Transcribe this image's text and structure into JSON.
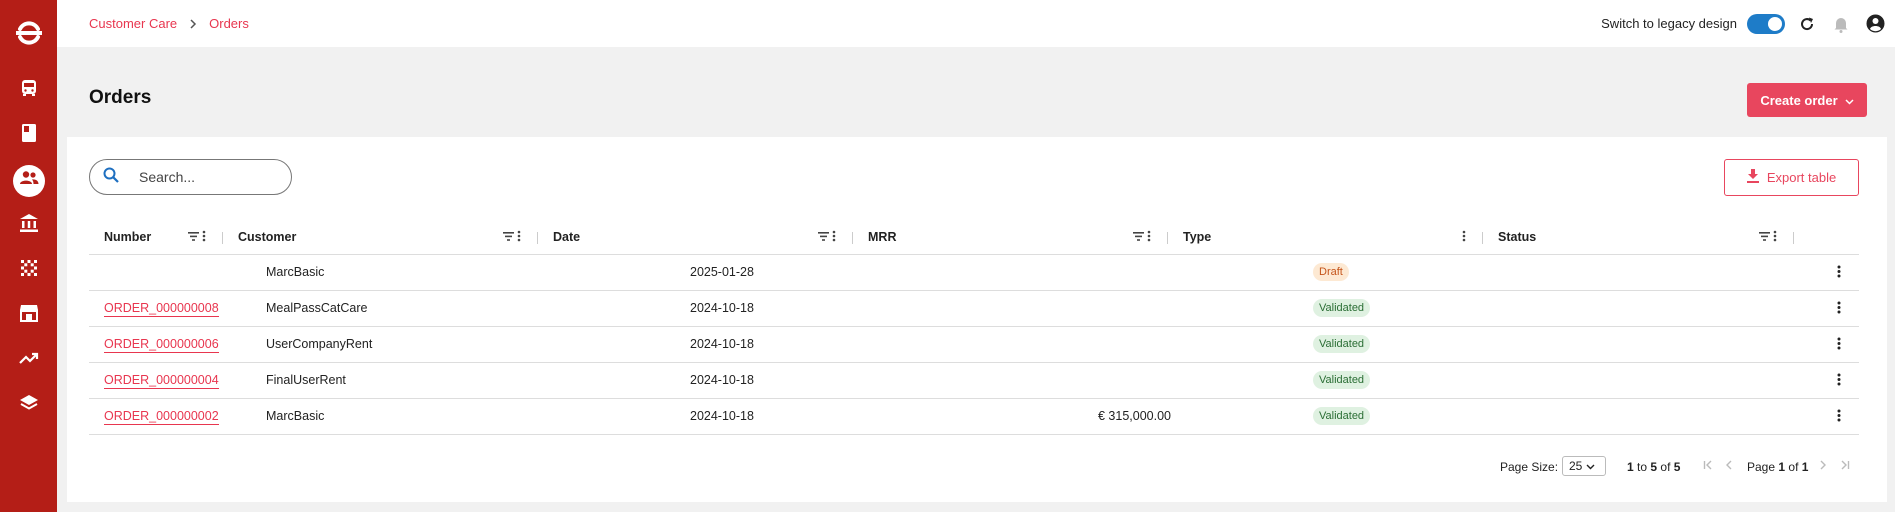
{
  "sidebar": {
    "logo": "logo-icon",
    "items": [
      {
        "icon": "bus-icon",
        "active": false
      },
      {
        "icon": "book-icon",
        "active": false
      },
      {
        "icon": "customers-icon",
        "active": true
      },
      {
        "icon": "bank-icon",
        "active": false
      },
      {
        "icon": "grid-dots-icon",
        "active": false
      },
      {
        "icon": "store-icon",
        "active": false
      },
      {
        "icon": "trending-icon",
        "active": false
      },
      {
        "icon": "layers-icon",
        "active": false
      }
    ]
  },
  "breadcrumb": {
    "parent": "Customer Care",
    "current": "Orders"
  },
  "topbar": {
    "legacy_label": "Switch to legacy design"
  },
  "page": {
    "title": "Orders",
    "create_label": "Create order"
  },
  "search": {
    "placeholder": "Search..."
  },
  "export_label": "Export table",
  "table": {
    "columns": {
      "number": "Number",
      "customer": "Customer",
      "date": "Date",
      "mrr": "MRR",
      "type": "Type",
      "status": "Status"
    },
    "rows": [
      {
        "number": "",
        "customer": "MarcBasic",
        "date": "2025-01-28",
        "mrr": "",
        "type": "",
        "status": "Draft"
      },
      {
        "number": "ORDER_000000008",
        "customer": "MealPassCatCare",
        "date": "2024-10-18",
        "mrr": "",
        "type": "",
        "status": "Validated"
      },
      {
        "number": "ORDER_000000006",
        "customer": "UserCompanyRent",
        "date": "2024-10-18",
        "mrr": "",
        "type": "",
        "status": "Validated"
      },
      {
        "number": "ORDER_000000004",
        "customer": "FinalUserRent",
        "date": "2024-10-18",
        "mrr": "",
        "type": "",
        "status": "Validated"
      },
      {
        "number": "ORDER_000000002",
        "customer": "MarcBasic",
        "date": "2024-10-18",
        "mrr": "€ 315,000.00",
        "type": "",
        "status": "Validated"
      }
    ]
  },
  "pager": {
    "page_size_label": "Page Size:",
    "page_size": "25",
    "range_from": "1",
    "range_to_word": "to",
    "range_to": "5",
    "of_word": "of",
    "total": "5",
    "page_word": "Page",
    "page_current": "1",
    "page_total": "1"
  },
  "colors": {
    "sidebar": "#b41e17",
    "accent": "#e8465e",
    "toggle": "#1e7cc8"
  }
}
